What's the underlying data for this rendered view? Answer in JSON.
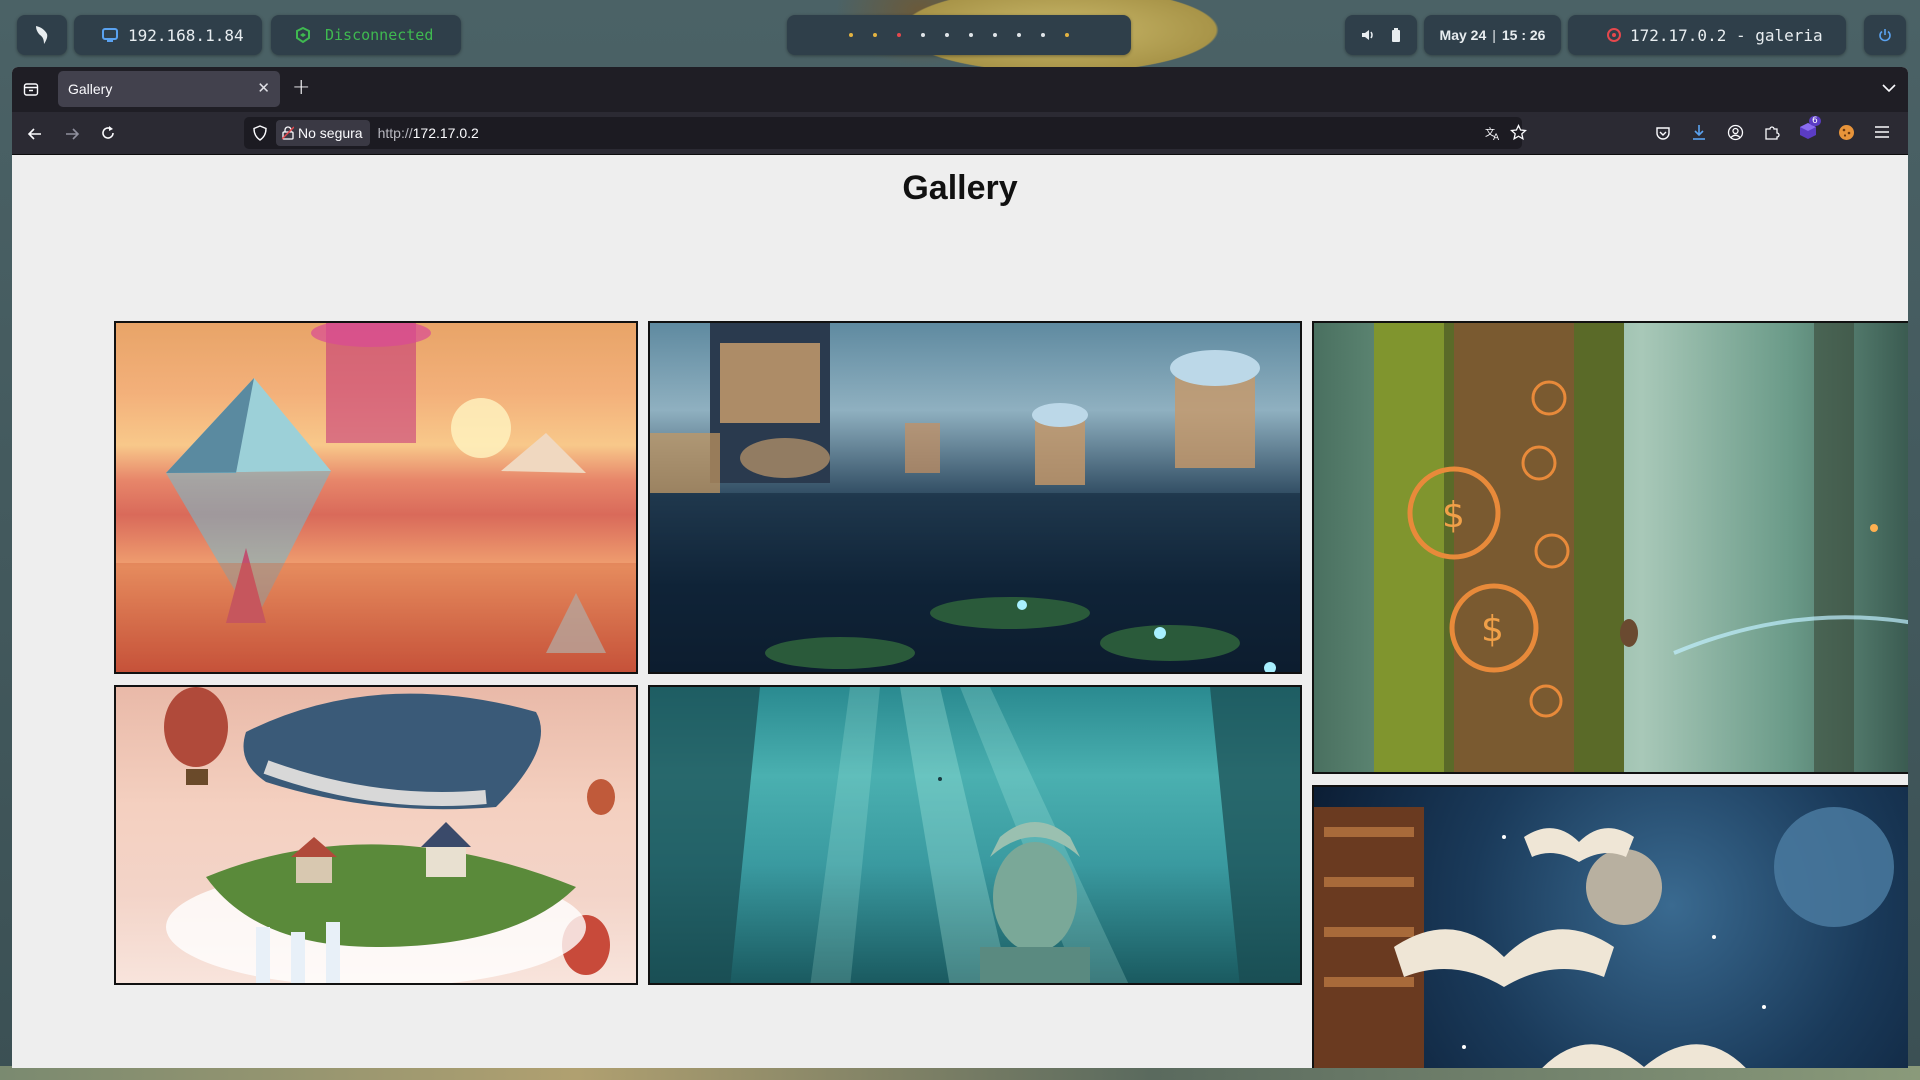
{
  "topbar": {
    "local_ip": "192.168.1.84",
    "vpn_status": "Disconnected",
    "date": "May 24",
    "time": "15 : 26",
    "target": "172.17.0.2 - galeria",
    "colors": {
      "vpn": "#3fb950",
      "target_icon": "#e5484d",
      "workspace_active": "#e3b341",
      "workspace_red": "#e5484d"
    }
  },
  "browser": {
    "tab_title": "Gallery",
    "security_label": "No segura",
    "url_scheme": "http://",
    "url_host": "172.17.0.2",
    "extension_badge": "6"
  },
  "page": {
    "heading": "Gallery",
    "images": [
      {
        "name": "desert-pyramids-jellyfish-sunset"
      },
      {
        "name": "futuristic-city-on-water-lotus"
      },
      {
        "name": "mossy-tree-with-glowing-coins"
      },
      {
        "name": "floating-whale-island-balloons"
      },
      {
        "name": "underwater-statue-light-rays"
      },
      {
        "name": "flying-books-in-space-library"
      }
    ]
  }
}
